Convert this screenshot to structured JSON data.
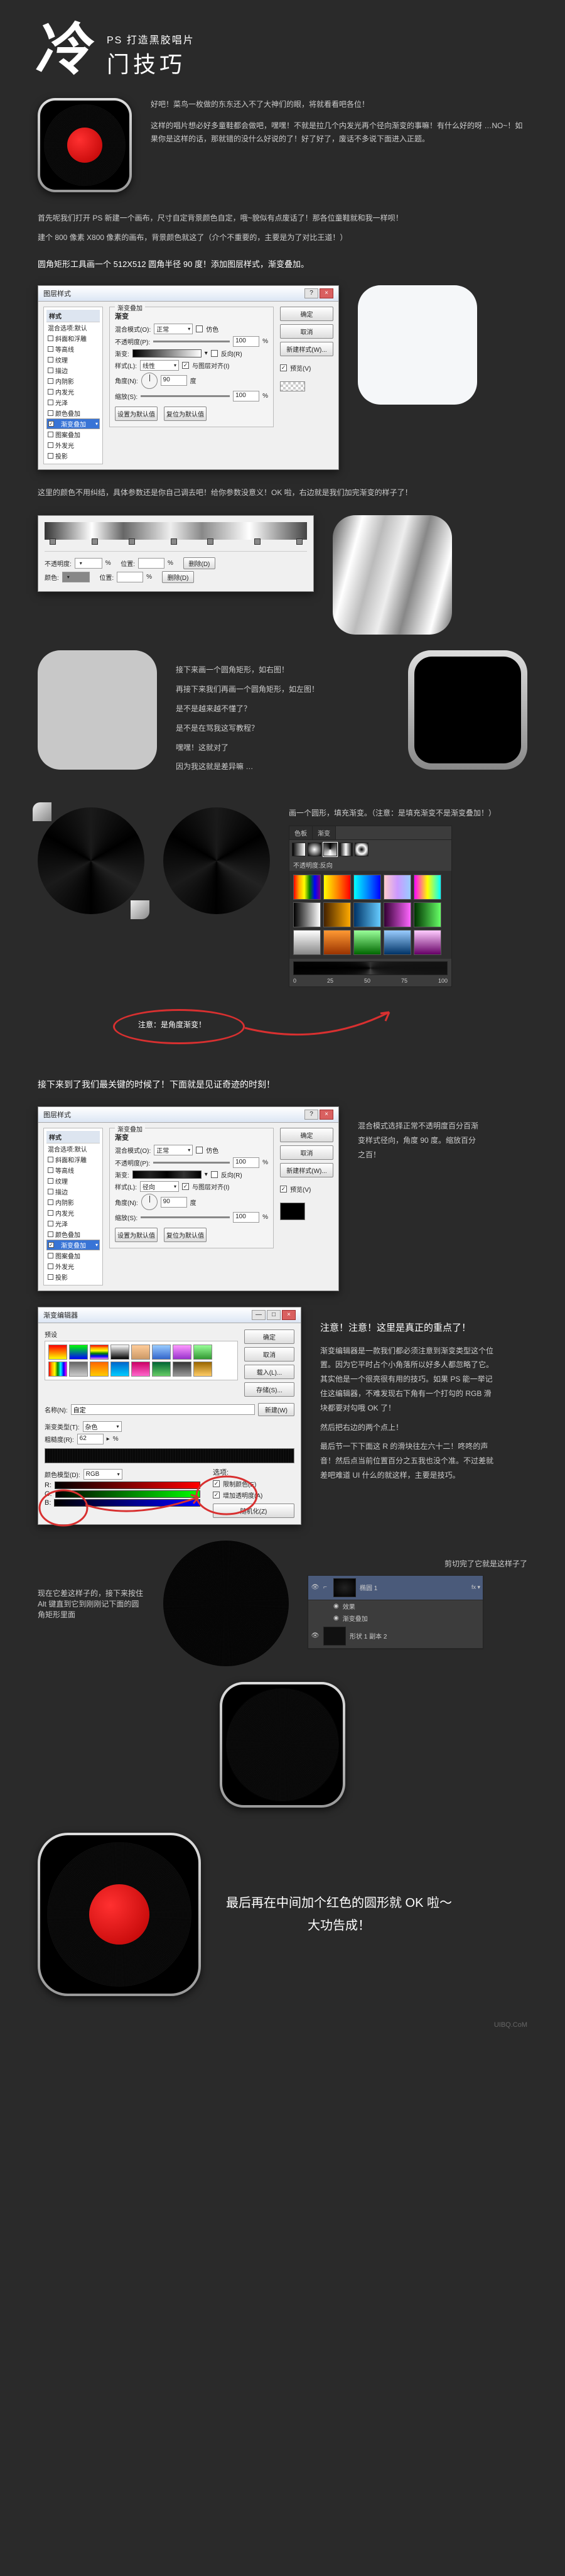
{
  "header": {
    "calligraphy": "冷",
    "title_en": "PS 打造黑胶唱片",
    "title_cn": "门技巧"
  },
  "intro": {
    "p1": "好吧！菜鸟一枚做的东东还入不了大神们的眼，将就看看吧各位！",
    "p2": "这样的唱片想必好多童鞋都会做吧，嘿嘿！不就是拉几个内发光再个径向渐变的事嘛！有什么好的呀 …NO~！如果你是这样的话，那就错的没什么好说的了！好了好了，废话不多说下面进入正题。"
  },
  "step0": {
    "p1": "首先呢我们打开 PS 新建一个画布，尺寸自定背景颜色自定，哦~貌似有点废话了！那各位童鞋就和我一样呗！",
    "p2": "建个 800 像素 X800 像素的画布，背景颜色就这了（介个不重要的，主要是为了对比王道！）"
  },
  "step1": {
    "label": "圆角矩形工具画一个 512X512 圆角半径 90 度！添加图层样式，渐变叠加。"
  },
  "dlg1": {
    "title": "图层样式",
    "side_header": "样式",
    "side_items": [
      "混合选项:默认",
      "斜面和浮雕",
      "等高线",
      "纹理",
      "描边",
      "内阴影",
      "内发光",
      "光泽",
      "颜色叠加",
      "渐变叠加",
      "图案叠加",
      "外发光",
      "投影"
    ],
    "group_title": "渐变叠加",
    "sub_title": "渐变",
    "blend_label": "混合模式(O):",
    "blend_val": "正常",
    "dither": "仿色",
    "opacity_label": "不透明度(P):",
    "opacity_val": "100",
    "gradient_label": "渐变:",
    "reverse": "反向(R)",
    "style_label": "样式(L):",
    "style_val": "线性",
    "align": "与图层对齐(I)",
    "angle_label": "角度(N):",
    "angle_val": "90",
    "scale_label": "缩放(S):",
    "scale_val": "100",
    "reset_btn": "设置为默认值",
    "default_btn": "复位为默认值",
    "ok": "确定",
    "cancel": "取消",
    "new_style": "新建样式(W)...",
    "preview": "预览(V)"
  },
  "step2": {
    "p1": "这里的颜色不用纠结，具体参数还是你自己调去吧！给你参数没意义！OK 啦，右边就是我们加完渐变的样子了！"
  },
  "gradpanel": {
    "opacity": "不透明度:",
    "pos": "位置:",
    "pct": "%",
    "del": "删除(D)",
    "col": "颜色:"
  },
  "step3": {
    "p1": "接下来画一个圆角矩形，如右图！",
    "p2": "再接下来我们再画一个圆角矩形，如左图！",
    "q1": "是不是越来越不懂了？",
    "q2": "是不是在骂我这写教程？",
    "q3": "嘿嘿！这就对了",
    "q4": "因为我这就是差异嘛 …"
  },
  "step4": {
    "p1": "画一个圆形，填充渐变。（注意：是填充渐变不是渐变叠加！）"
  },
  "darkpanel": {
    "tabs": [
      "色板",
      "渐变"
    ],
    "opt": "不透明度:",
    "rev": "反向"
  },
  "red_annotation": "注意：是角度渐变！",
  "step5": {
    "p1": "接下来到了我们最关键的时候了！下面就是见证奇迹的时刻！"
  },
  "dlg2": {
    "note": "混合模式选择正常不透明度百分百渐变样式径向，角度 90 度。缩放百分之百！",
    "style_val": "径向"
  },
  "step6": {
    "title": "注意！注意！这里是真正的重点了！",
    "p1": "渐变编辑器是一款我们都必须注意到渐变类型这个位置。因为它平时占个小角落所以好多人都忽略了它。其实他是一个很亮很有用的技巧。如果 PS 能一举记住这编辑器，不难发现右下角有一个打勾的 RGB 滑块都要对勾哦 OK 了！",
    "p2": "然后把右边的两个点上！",
    "p3": "最后节一下下面这 R 的滑块往左六十二！咚咚的声音！然后点当前位置百分之五我也没个准。不过差就差吧难道 UI 什么的就这样，主要是技巧。"
  },
  "gradedit": {
    "title": "渐变编辑器",
    "presets": "预设",
    "ok": "确定",
    "cancel": "取消",
    "load": "载入(L)...",
    "save": "存储(S)...",
    "name_label": "名称(N):",
    "name_val": "自定",
    "new": "新建(W)",
    "type_label": "渐变类型(T):",
    "type_val": "杂色",
    "rough_label": "粗糙度(R):",
    "rough_val": "62",
    "model_label": "颜色模型(D):",
    "model_val": "RGB",
    "options": "选项:",
    "opt1": "限制颜色(E)",
    "opt2": "增加透明度(A)",
    "rand": "随机化(Z)",
    "r": "R:",
    "g": "G:",
    "b": "B:"
  },
  "step7": {
    "p1": "现在它差这样子的，接下来按住 Alt 键直到它到刚刚记下面的圆角矩形里面",
    "p2": "剪切完了它就是这样子了"
  },
  "layers": {
    "l1": "椭圆 1",
    "fx": "效果",
    "fx1": "渐变叠加",
    "l2": "形状 1 副本 2"
  },
  "final": {
    "p1": "最后再在中间加个红色的圆形就 OK 啦～",
    "p2": "大功告成！"
  },
  "watermark": "UIBQ.CoM"
}
